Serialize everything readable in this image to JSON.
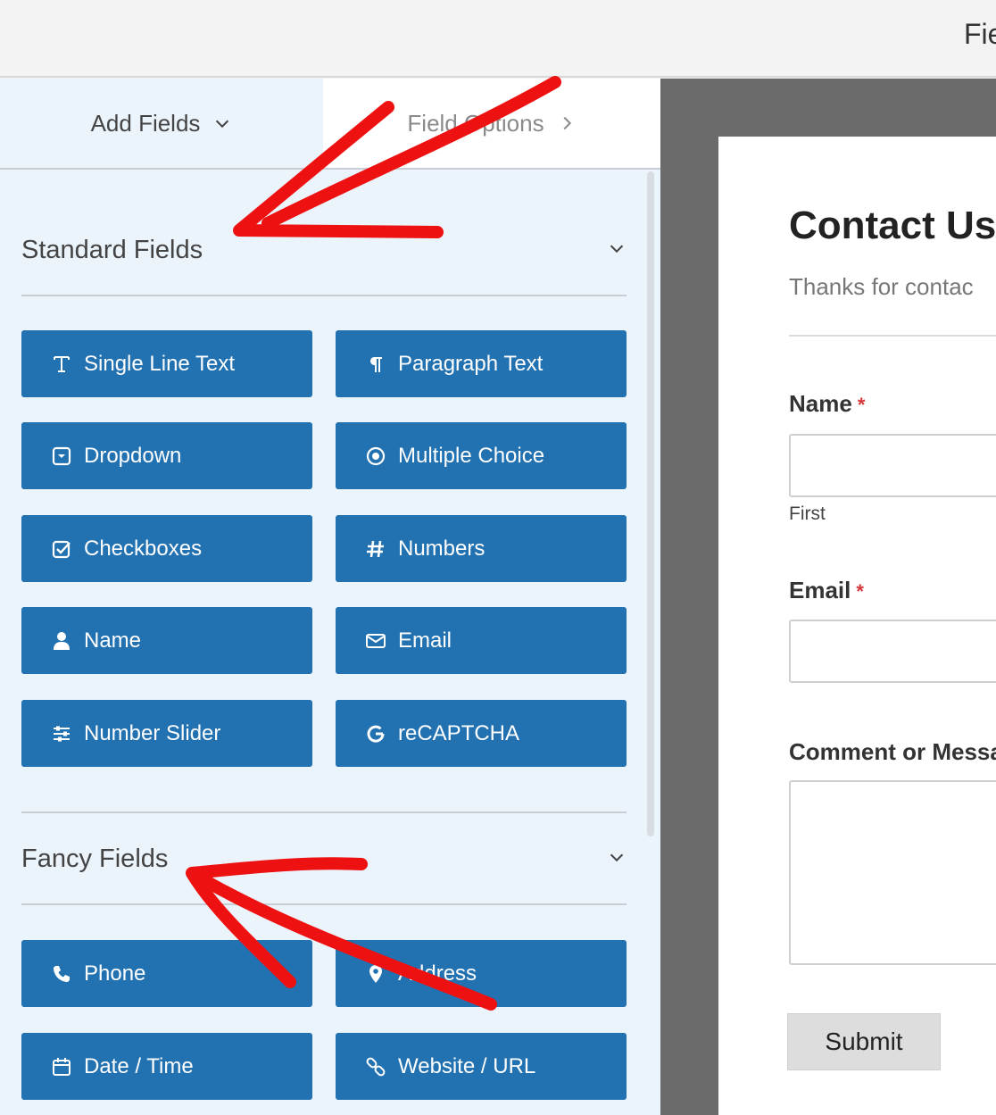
{
  "topbar": {
    "title": "Fie"
  },
  "tabs": {
    "add_fields": "Add Fields",
    "field_options": "Field Options"
  },
  "sections": {
    "standard": {
      "title": "Standard Fields",
      "fields": [
        {
          "label": "Single Line Text",
          "icon": "text-cursor-icon"
        },
        {
          "label": "Paragraph Text",
          "icon": "paragraph-icon"
        },
        {
          "label": "Dropdown",
          "icon": "dropdown-icon"
        },
        {
          "label": "Multiple Choice",
          "icon": "radio-icon"
        },
        {
          "label": "Checkboxes",
          "icon": "checkbox-icon"
        },
        {
          "label": "Numbers",
          "icon": "hash-icon"
        },
        {
          "label": "Name",
          "icon": "user-icon"
        },
        {
          "label": "Email",
          "icon": "envelope-icon"
        },
        {
          "label": "Number Slider",
          "icon": "sliders-icon"
        },
        {
          "label": "reCAPTCHA",
          "icon": "google-icon"
        }
      ]
    },
    "fancy": {
      "title": "Fancy Fields",
      "fields": [
        {
          "label": "Phone",
          "icon": "phone-icon"
        },
        {
          "label": "Address",
          "icon": "map-pin-icon"
        },
        {
          "label": "Date / Time",
          "icon": "calendar-icon"
        },
        {
          "label": "Website / URL",
          "icon": "link-icon"
        }
      ]
    }
  },
  "form": {
    "title": "Contact Us",
    "description": "Thanks for contac",
    "name_label": "Name",
    "name_sublabel": "First",
    "email_label": "Email",
    "comment_label": "Comment or Messa",
    "required_mark": "*",
    "submit_label": "Submit"
  },
  "colors": {
    "accent": "#2271b1",
    "annotation": "#ee1111",
    "required": "#d63638"
  }
}
